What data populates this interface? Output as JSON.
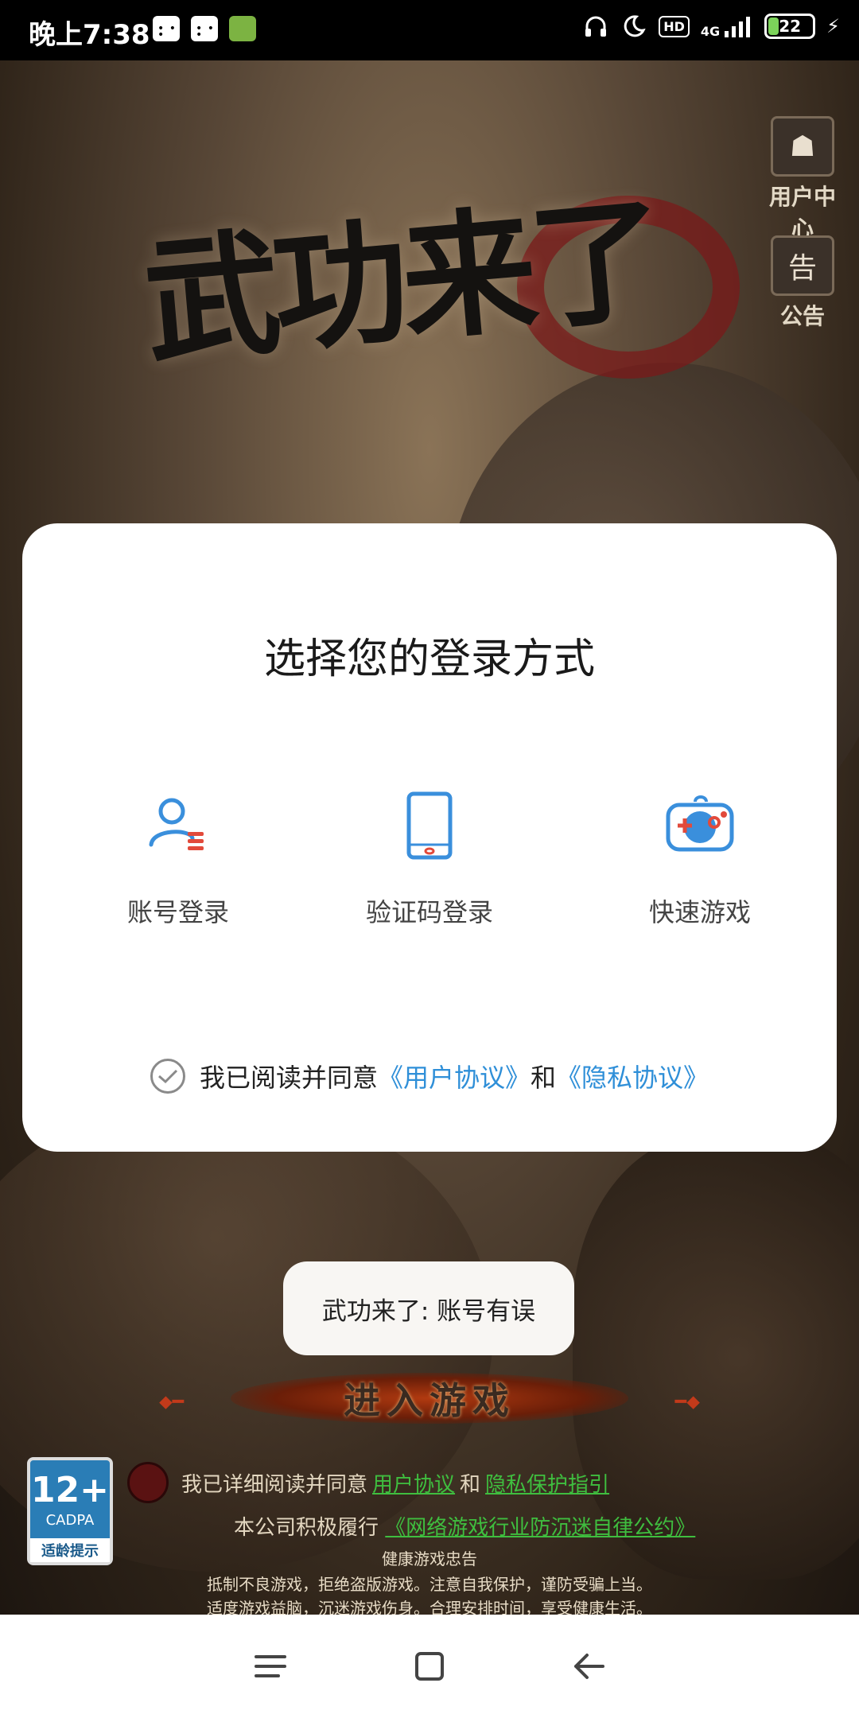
{
  "status_bar": {
    "time": "晚上7:38",
    "hd": "HD",
    "network": "4G",
    "battery": "22",
    "battery_level": 0.22
  },
  "game": {
    "logo_text": "武功来了",
    "user_center_label": "用户中心",
    "notice_label": "公告",
    "notice_glyph": "告",
    "enter_label": "进入游戏"
  },
  "dialog": {
    "title": "选择您的登录方式",
    "options": [
      {
        "label": "账号登录",
        "icon": "account-icon"
      },
      {
        "label": "验证码登录",
        "icon": "phone-icon"
      },
      {
        "label": "快速游戏",
        "icon": "gamepad-icon"
      }
    ],
    "agreement": {
      "prefix": "我已阅读并同意",
      "user_agreement": "《用户协议》",
      "and": "和",
      "privacy": "《隐私协议》"
    }
  },
  "toast": {
    "text": "武功来了: 账号有误"
  },
  "age_rating": {
    "number": "12+",
    "org": "CADPA",
    "tip": "适龄提示"
  },
  "footer": {
    "line1_prefix": "我已详细阅读并同意",
    "line1_link1": "用户协议",
    "line1_and": "和",
    "line1_link2": "隐私保护指引",
    "line2_prefix": "本公司积极履行",
    "line2_link": "《网络游戏行业防沉迷自律公约》",
    "health_title": "健康游戏忠告",
    "health_line1": "抵制不良游戏，拒绝盗版游戏。注意自我保护，谨防受骗上当。",
    "health_line2": "适度游戏益脑，沉迷游戏伤身。合理安排时间，享受健康生活。"
  },
  "colors": {
    "link": "#2f8fd8",
    "icon_blue": "#3a8fdc",
    "icon_red": "#e24a3b"
  }
}
